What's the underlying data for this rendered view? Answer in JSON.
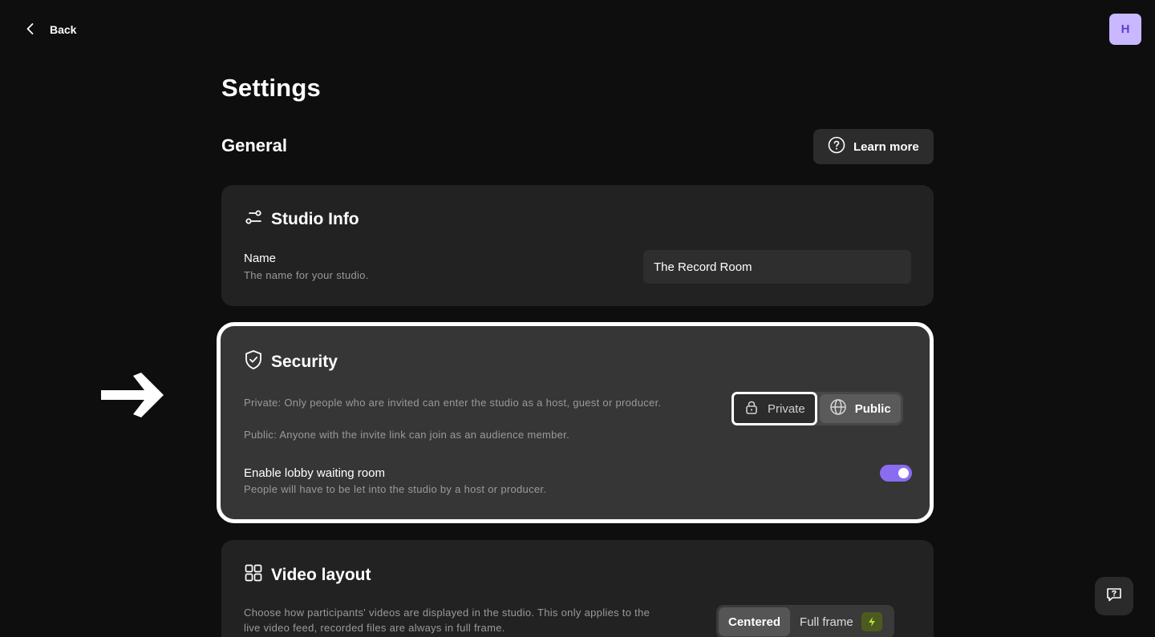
{
  "nav": {
    "back_label": "Back",
    "avatar_initial": "H"
  },
  "page": {
    "title": "Settings",
    "section_title": "General",
    "learn_more_label": "Learn more"
  },
  "studio_info": {
    "title": "Studio Info",
    "name_label": "Name",
    "name_desc": "The name for your studio.",
    "name_value": "The Record Room"
  },
  "security": {
    "title": "Security",
    "private_desc": "Private: Only people who are invited can enter the studio as a host, guest or producer.",
    "public_desc": "Public: Anyone with the invite link can join as an audience member.",
    "private_label": "Private",
    "public_label": "Public",
    "lobby_label": "Enable lobby waiting room",
    "lobby_desc": "People will have to be let into the studio by a host or producer.",
    "lobby_enabled": true
  },
  "video_layout": {
    "title": "Video layout",
    "desc_line1": "Choose how participants' videos are displayed in the studio. This only applies to the",
    "desc_line2": "live video feed, recorded files are always in full frame.",
    "centered_label": "Centered",
    "full_frame_label": "Full frame"
  },
  "colors": {
    "accent": "#8a6cf0",
    "avatar_bg": "#c9b8ff",
    "bolt_bg": "#4b5b1e",
    "bolt": "#b8e03c"
  },
  "icons": [
    "chevron-left-icon",
    "question-circle-icon",
    "sliders-icon",
    "shield-check-icon",
    "lock-icon",
    "globe-icon",
    "grid-icon",
    "bolt-icon",
    "arrow-right-icon",
    "help-chat-icon"
  ]
}
